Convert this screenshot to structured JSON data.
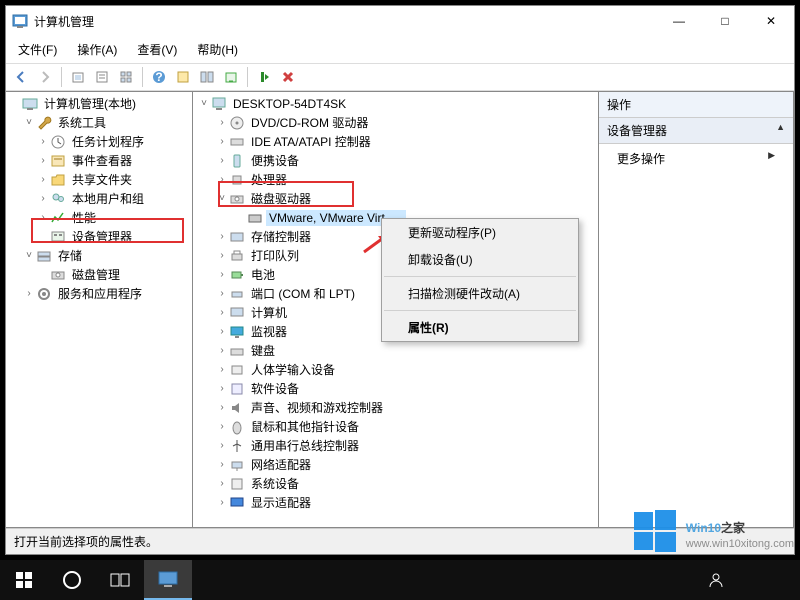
{
  "window": {
    "title": "计算机管理",
    "buttons": {
      "min": "—",
      "max": "□",
      "close": "✕"
    }
  },
  "menu": {
    "file": "文件(F)",
    "action": "操作(A)",
    "view": "查看(V)",
    "help": "帮助(H)"
  },
  "toolbar_icons": [
    "back",
    "forward",
    "up",
    "props",
    "tiles",
    "help",
    "view1",
    "view2",
    "refresh",
    "stop",
    "delete"
  ],
  "left_tree": {
    "root": "计算机管理(本地)",
    "system_tools": "系统工具",
    "task_scheduler": "任务计划程序",
    "event_viewer": "事件查看器",
    "shared_folders": "共享文件夹",
    "local_users": "本地用户和组",
    "performance": "性能",
    "device_manager": "设备管理器",
    "storage": "存储",
    "disk_mgmt": "磁盘管理",
    "services_apps": "服务和应用程序"
  },
  "mid_tree": {
    "root": "DESKTOP-54DT4SK",
    "dvd": "DVD/CD-ROM 驱动器",
    "ide": "IDE ATA/ATAPI 控制器",
    "portable": "便携设备",
    "processor": "处理器",
    "disk_drives": "磁盘驱动器",
    "disk_item": "VMware, VMware Virtual S SCSI Disk Device",
    "storage_ctrl": "存储控制器",
    "print_queue": "打印队列",
    "battery": "电池",
    "ports": "端口 (COM 和 LPT)",
    "computer": "计算机",
    "monitor": "监视器",
    "keyboard": "键盘",
    "hid": "人体学输入设备",
    "software_dev": "软件设备",
    "sound": "声音、视频和游戏控制器",
    "mouse": "鼠标和其他指针设备",
    "usb": "通用串行总线控制器",
    "network": "网络适配器",
    "system_dev": "系统设备",
    "display": "显示适配器"
  },
  "context_menu": {
    "update_driver": "更新驱动程序(P)",
    "uninstall": "卸载设备(U)",
    "scan": "扫描检测硬件改动(A)",
    "properties": "属性(R)"
  },
  "actions_pane": {
    "header": "操作",
    "sub_header": "设备管理器",
    "more": "更多操作"
  },
  "statusbar": "打开当前选择项的属性表。",
  "watermark": {
    "line1a": "Win10",
    "line1b": "之家",
    "line2": "www.win10xitong.com"
  }
}
